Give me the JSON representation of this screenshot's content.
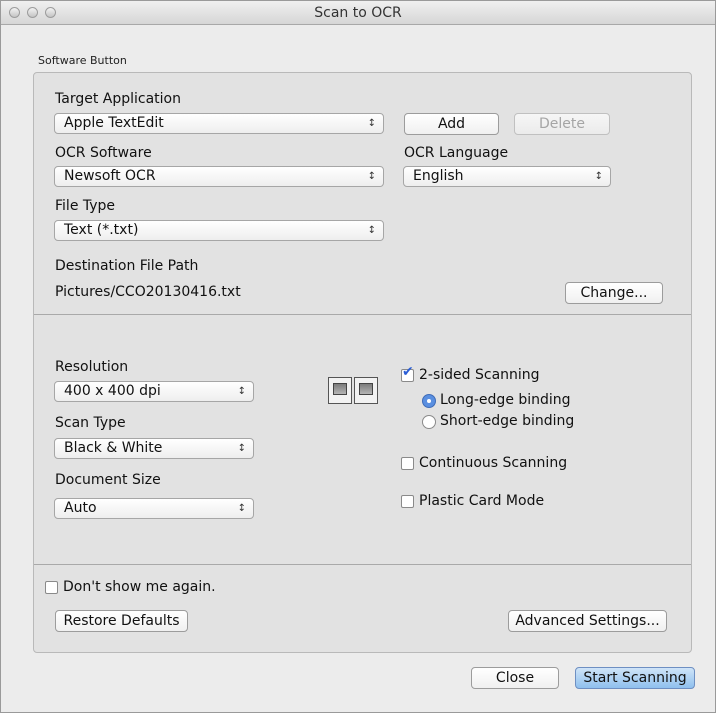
{
  "window": {
    "title": "Scan to OCR"
  },
  "section": {
    "label": "Software Button"
  },
  "target_app": {
    "label": "Target Application",
    "value": "Apple TextEdit"
  },
  "buttons": {
    "add": "Add",
    "delete": "Delete",
    "change": "Change...",
    "restore": "Restore Defaults",
    "advanced": "Advanced Settings...",
    "close": "Close",
    "start": "Start Scanning"
  },
  "ocr_software": {
    "label": "OCR Software",
    "value": "Newsoft OCR"
  },
  "ocr_language": {
    "label": "OCR Language",
    "value": "English"
  },
  "file_type": {
    "label": "File Type",
    "value": "Text (*.txt)"
  },
  "destination": {
    "label": "Destination File Path",
    "value": "Pictures/CCO20130416.txt"
  },
  "resolution": {
    "label": "Resolution",
    "value": "400 x 400 dpi"
  },
  "scan_type": {
    "label": "Scan Type",
    "value": "Black & White"
  },
  "document_size": {
    "label": "Document Size",
    "value": "Auto"
  },
  "two_sided": {
    "label": "2-sided Scanning",
    "checked": true,
    "options": [
      {
        "label": "Long-edge binding",
        "selected": true
      },
      {
        "label": "Short-edge binding",
        "selected": false
      }
    ]
  },
  "continuous": {
    "label": "Continuous Scanning",
    "checked": false
  },
  "plastic_card": {
    "label": "Plastic Card Mode",
    "checked": false
  },
  "dont_show": {
    "label": "Don't show me again.",
    "checked": false
  },
  "icons": {
    "popup_arrows": "↕",
    "check": "✔",
    "duplex_icon": "two-sided-pages-icon"
  },
  "colors": {
    "accent": "#5a8fe0",
    "primary_button": "#8fc0ee"
  }
}
